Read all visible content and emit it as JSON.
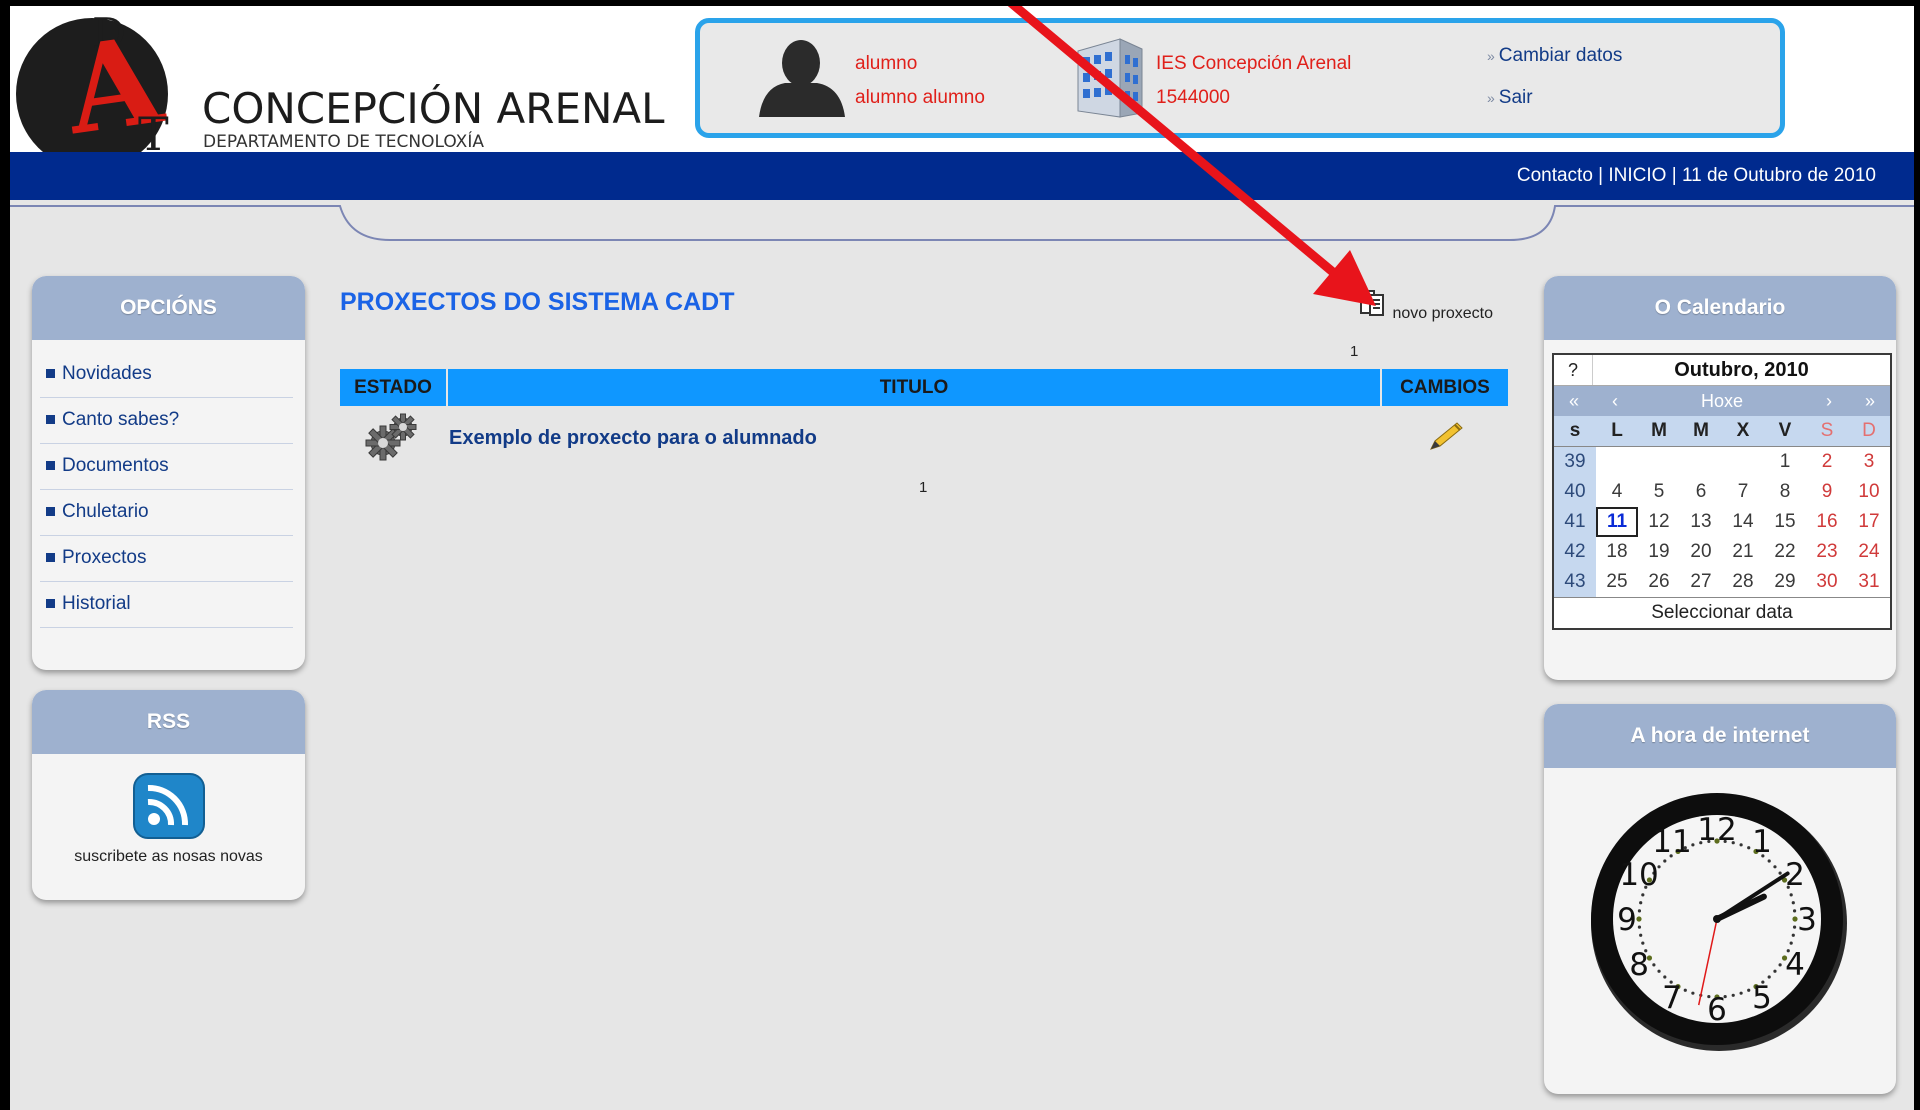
{
  "header": {
    "logo": {
      "letters": [
        "D",
        "A",
        "T"
      ],
      "title": "CONCEPCIÓN ARENAL",
      "subtitle": "DEPARTAMENTO DE TECNOLOXÍA"
    },
    "user": {
      "login": "alumno",
      "full_name": "alumno alumno"
    },
    "school": {
      "name": "IES Concepción Arenal",
      "code": "1544000"
    },
    "links": {
      "change_data": "Cambiar datos",
      "logout": "Sair"
    }
  },
  "topnav": {
    "contact": "Contacto",
    "sep": " | ",
    "home": "INICIO",
    "date": "11 de Outubro de 2010"
  },
  "sidebar": {
    "options_title": "OPCIÓNS",
    "items": [
      {
        "label": "Novidades"
      },
      {
        "label": "Canto sabes?"
      },
      {
        "label": "Documentos"
      },
      {
        "label": "Chuletario"
      },
      {
        "label": "Proxectos"
      },
      {
        "label": "Historial"
      }
    ],
    "rss_title": "RSS",
    "rss_text": "suscribete as nosas novas"
  },
  "main": {
    "title": "PROXECTOS DO SISTEMA CADT",
    "new_project": "novo proxecto",
    "page_top": "1",
    "page_bottom": "1",
    "table": {
      "headers": {
        "state": "ESTADO",
        "title": "TITULO",
        "changes": "CAMBIOS"
      },
      "rows": [
        {
          "title": "Exemplo de proxecto para o alumnado",
          "state_icon": "gears-icon",
          "edit_icon": "pencil-icon"
        }
      ]
    }
  },
  "calendar": {
    "box_title": "O Calendario",
    "help": "?",
    "month": "Outubro, 2010",
    "nav": {
      "prev_year": "«",
      "prev_month": "‹",
      "today": "Hoxe",
      "next_month": "›",
      "next_year": "»"
    },
    "weekdays": [
      "s",
      "L",
      "M",
      "M",
      "X",
      "V",
      "S",
      "D"
    ],
    "weeks": [
      [
        "39",
        "",
        "",
        "",
        "",
        "1",
        "2",
        "3"
      ],
      [
        "40",
        "4",
        "5",
        "6",
        "7",
        "8",
        "9",
        "10"
      ],
      [
        "41",
        "11",
        "12",
        "13",
        "14",
        "15",
        "16",
        "17"
      ],
      [
        "42",
        "18",
        "19",
        "20",
        "21",
        "22",
        "23",
        "24"
      ],
      [
        "43",
        "25",
        "26",
        "27",
        "28",
        "29",
        "30",
        "31"
      ]
    ],
    "today": "11",
    "footer": "Seleccionar data"
  },
  "clock": {
    "box_title": "A hora de internet",
    "numbers": [
      "12",
      "1",
      "2",
      "3",
      "4",
      "5",
      "6",
      "7",
      "8",
      "9",
      "10",
      "11"
    ],
    "time": {
      "hour": 2,
      "minute": 9,
      "second": 32
    }
  },
  "colors": {
    "accent_blue": "#0f97ff",
    "nav_blue": "#002a8e",
    "box_head": "#9eb1cf",
    "link": "#123b87",
    "red": "#e0201a"
  }
}
